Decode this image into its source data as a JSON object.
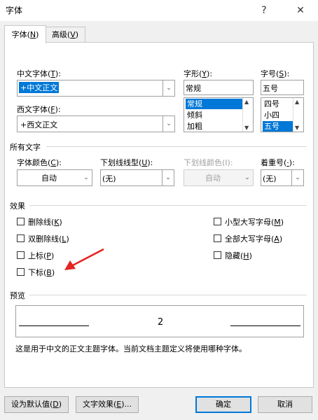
{
  "window": {
    "title": "字体",
    "help": "?",
    "close": "✕"
  },
  "tabs": [
    {
      "label": "字体(",
      "key": "N",
      "tail": ")"
    },
    {
      "label": "高级(",
      "key": "V",
      "tail": ")"
    }
  ],
  "font": {
    "cn_label": "中文字体(",
    "cn_key": "T",
    "cn_tail": "):",
    "cn_value": "+中文正文",
    "west_label": "西文字体(",
    "west_key": "F",
    "west_tail": "):",
    "west_value": "+西文正文",
    "style_label": "字形(",
    "style_key": "Y",
    "style_tail": "):",
    "style_value": "常规",
    "style_options": [
      "常规",
      "倾斜",
      "加粗"
    ],
    "size_label": "字号(",
    "size_key": "S",
    "size_tail": "):",
    "size_value": "五号",
    "size_options": [
      "四号",
      "小四",
      "五号"
    ]
  },
  "all_text": {
    "section": "所有文字",
    "color_label": "字体颜色(",
    "color_key": "C",
    "color_tail": "):",
    "color_value": "自动",
    "underline_label": "下划线线型(",
    "underline_key": "U",
    "underline_tail": "):",
    "underline_value": "(无)",
    "underline_color_label": "下划线颜色(I):",
    "underline_color_value": "自动",
    "emphasis_label": "着重号(",
    "emphasis_key": "·",
    "emphasis_tail": "):",
    "emphasis_value": "(无)"
  },
  "effects": {
    "section": "效果",
    "items": [
      {
        "pre": "删除线(",
        "key": "K",
        "post": ")"
      },
      {
        "pre": "双删除线(",
        "key": "L",
        "post": ")"
      },
      {
        "pre": "上标(",
        "key": "P",
        "post": ")"
      },
      {
        "pre": "下标(",
        "key": "B",
        "post": ")"
      },
      {
        "pre": "小型大写字母(",
        "key": "M",
        "post": ")"
      },
      {
        "pre": "全部大写字母(",
        "key": "A",
        "post": ")"
      },
      {
        "pre": "隐藏(",
        "key": "H",
        "post": ")"
      }
    ]
  },
  "preview": {
    "section": "预览",
    "sample": "2",
    "note": "这是用于中文的正文主题字体。当前文档主题定义将使用哪种字体。"
  },
  "buttons": {
    "default_pre": "设为默认值(",
    "default_key": "D",
    "default_post": ")",
    "effects_pre": "文字效果(",
    "effects_key": "E",
    "effects_post": ")...",
    "ok": "确定",
    "cancel": "取消"
  },
  "colors": {
    "accent": "#0078d7",
    "arrow": "#e52320"
  }
}
